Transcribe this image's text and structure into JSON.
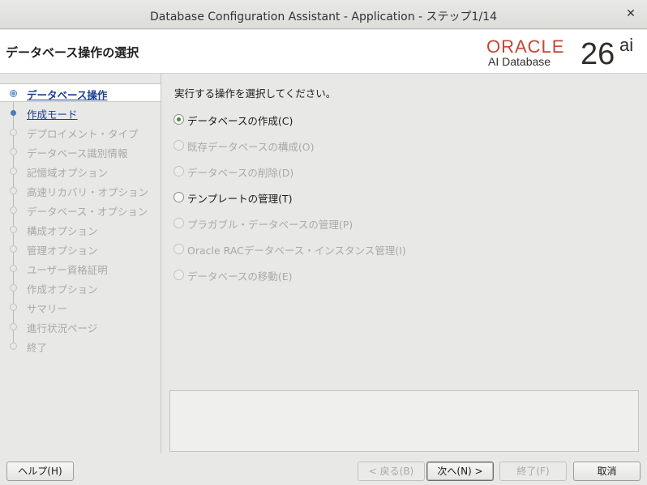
{
  "window": {
    "title": "Database Configuration Assistant - Application - ステップ1/14",
    "close_glyph": "✕"
  },
  "header": {
    "page_title": "データベース操作の選択",
    "logo": {
      "oracle": "ORACLE",
      "product": "AI Database",
      "version": "26",
      "suffix": "ai",
      "brand_color": "#c74634"
    }
  },
  "steps": [
    {
      "label": "データベース操作",
      "state": "active"
    },
    {
      "label": "作成モード",
      "state": "next"
    },
    {
      "label": "デプロイメント・タイプ",
      "state": "disabled"
    },
    {
      "label": "データベース識別情報",
      "state": "disabled"
    },
    {
      "label": "記憶域オプション",
      "state": "disabled"
    },
    {
      "label": "高速リカバリ・オプション",
      "state": "disabled"
    },
    {
      "label": "データベース・オプション",
      "state": "disabled"
    },
    {
      "label": "構成オプション",
      "state": "disabled"
    },
    {
      "label": "管理オプション",
      "state": "disabled"
    },
    {
      "label": "ユーザー資格証明",
      "state": "disabled"
    },
    {
      "label": "作成オプション",
      "state": "disabled"
    },
    {
      "label": "サマリー",
      "state": "disabled"
    },
    {
      "label": "進行状況ページ",
      "state": "disabled"
    },
    {
      "label": "終了",
      "state": "disabled"
    }
  ],
  "main": {
    "prompt": "実行する操作を選択してください。",
    "options": [
      {
        "label": "データベースの作成(C)",
        "selected": true,
        "enabled": true
      },
      {
        "label": "既存データベースの構成(O)",
        "selected": false,
        "enabled": false
      },
      {
        "label": "データベースの削除(D)",
        "selected": false,
        "enabled": false
      },
      {
        "label": "テンプレートの管理(T)",
        "selected": false,
        "enabled": true
      },
      {
        "label": "プラガブル・データベースの管理(P)",
        "selected": false,
        "enabled": false
      },
      {
        "label": "Oracle RACデータベース・インスタンス管理(I)",
        "selected": false,
        "enabled": false
      },
      {
        "label": "データベースの移動(E)",
        "selected": false,
        "enabled": false
      }
    ]
  },
  "buttons": {
    "help": "ヘルプ(H)",
    "back": "< 戻る(B)",
    "next": "次へ(N) >",
    "finish": "終了(F)",
    "cancel": "取消"
  }
}
